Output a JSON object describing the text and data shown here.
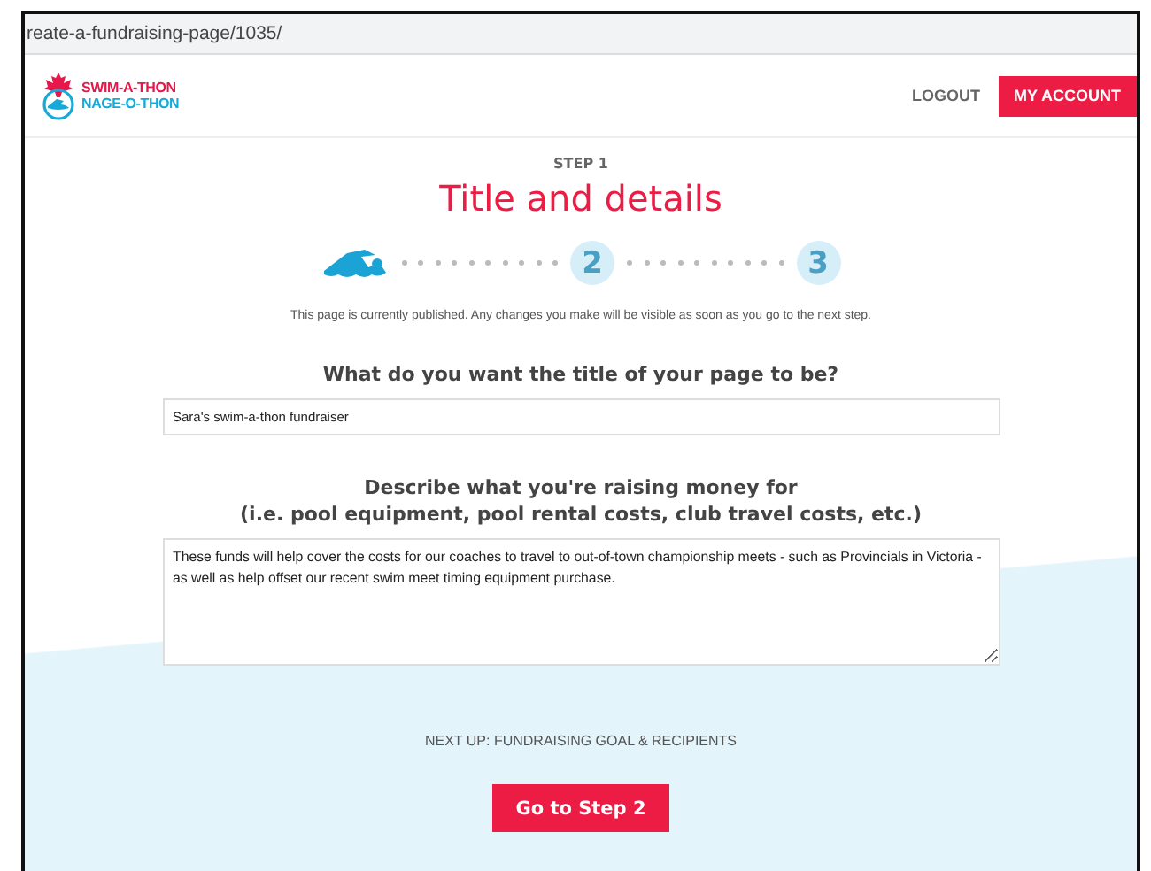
{
  "address_bar": {
    "url": "reate-a-fundraising-page/1035/"
  },
  "header": {
    "logo": {
      "line_1": "SWIM-A-THON",
      "line_2": "NAGE-O-THON"
    },
    "nav": [
      {
        "kind": "link",
        "label": "LOGOUT"
      },
      {
        "kind": "primary",
        "label": "MY ACCOUNT"
      }
    ]
  },
  "step_label": "STEP 1",
  "heading": "Title and details",
  "steps": [
    {
      "current": true
    },
    {
      "label": "2",
      "current": false
    },
    {
      "label": "3",
      "current": false
    }
  ],
  "notice": "This page is currently published. Any changes you make will be visible as soon as you go to the next step.",
  "title_question": "What do you want the title of your page to be?",
  "title_field": {
    "value": "Sara's swim-a-thon fundraiser"
  },
  "description_question": [
    "Describe what you're raising money for",
    "(i.e. pool equipment, pool rental costs, club travel costs, etc.)"
  ],
  "description_field": {
    "value": "These funds will help cover the costs for our coaches to travel to out-of-town championship meets - such as Provincials in Victoria - as well as help offset our recent swim meet timing equipment purchase."
  },
  "next_up": "NEXT UP: FUNDRAISING GOAL & RECIPIENTS",
  "next_button": "Go to Step 2"
}
